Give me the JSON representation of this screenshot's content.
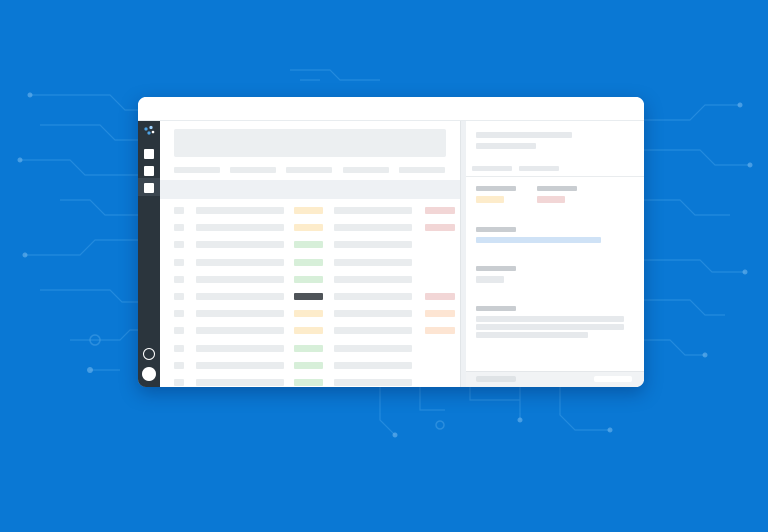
{
  "theme": {
    "background": "#0a78d4",
    "sidebar_bg": "#2b353d",
    "status_colors": {
      "yellow": "#fdeccb",
      "green": "#d7efd9",
      "red": "#f2d6d6",
      "dark": "#4f5459",
      "orange": "#fde5d3",
      "blue_link": "#cfe2f6"
    }
  },
  "sidebar": {
    "logo_icon": "dots-logo-icon",
    "items": [
      {
        "icon": "square-icon"
      },
      {
        "icon": "square-icon"
      },
      {
        "icon": "square-icon",
        "active": true
      }
    ],
    "bottom": [
      {
        "icon": "circle-outline-icon"
      },
      {
        "icon": "avatar-circle-icon"
      }
    ]
  },
  "table": {
    "rows": [
      {
        "status": "yellow",
        "tag": "red"
      },
      {
        "status": "yellow",
        "tag": "red"
      },
      {
        "status": "green",
        "tag": "none"
      },
      {
        "status": "green",
        "tag": "none"
      },
      {
        "status": "green",
        "tag": "none"
      },
      {
        "status": "dark",
        "tag": "red"
      },
      {
        "status": "yellow",
        "tag": "orange"
      },
      {
        "status": "yellow",
        "tag": "orange"
      },
      {
        "status": "green",
        "tag": "none"
      },
      {
        "status": "green",
        "tag": "none"
      },
      {
        "status": "green",
        "tag": "none"
      }
    ]
  },
  "panel": {
    "fields": [
      {
        "value_color": "yellow"
      },
      {
        "value_color": "red"
      },
      {
        "value_color": "blue_link"
      }
    ]
  }
}
